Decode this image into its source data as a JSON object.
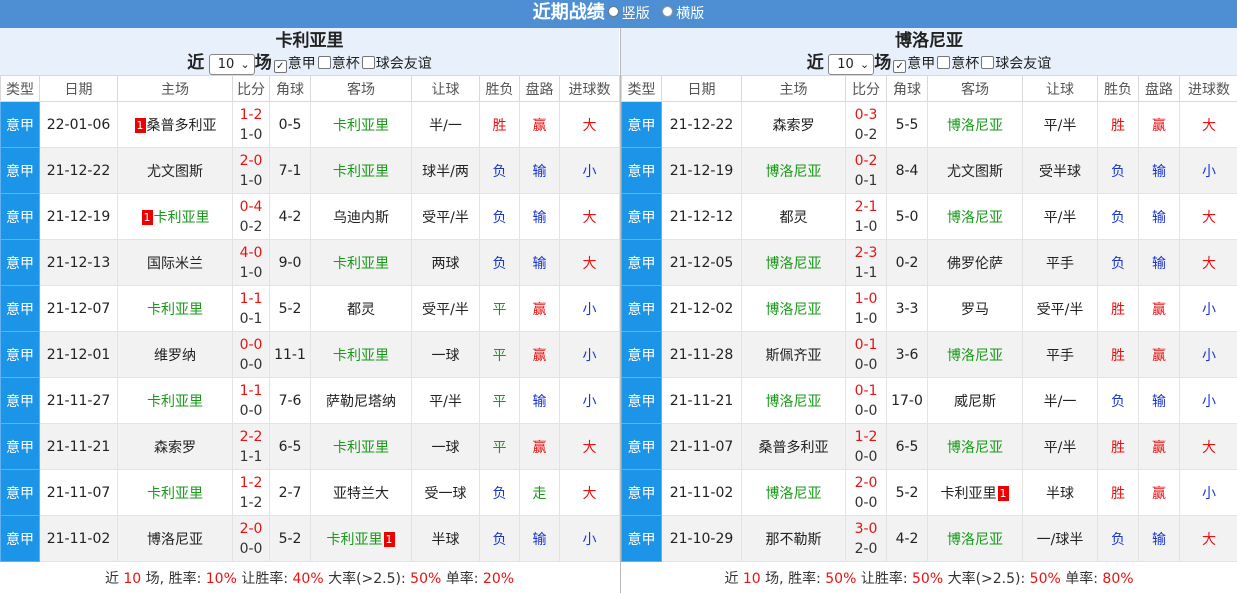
{
  "header": {
    "title": "近期战绩",
    "option_vertical": "竖版",
    "option_horizontal": "横版"
  },
  "colors": {
    "title_bar": "#4d8fd2",
    "type_cell": "#1c95e8",
    "win": "#e81212",
    "lose": "#1a35d6",
    "draw": "#189a18"
  },
  "columns": [
    "类型",
    "日期",
    "主场",
    "比分",
    "角球",
    "客场",
    "让球",
    "胜负",
    "盘路",
    "进球数"
  ],
  "left": {
    "team": "卡利亚里",
    "filter_near": "近",
    "filter_count": "10",
    "filter_unit": "场",
    "cb_serie_a": "意甲",
    "cb_cup": "意杯",
    "cb_friendly": "球会友谊",
    "rows": [
      {
        "type": "意甲",
        "date": "22-01-06",
        "home": "桑普多利亚",
        "home_card": "1",
        "score": "1-2",
        "half": "1-0",
        "corner": "0-5",
        "away": "卡利亚里",
        "away_card": "",
        "hcap": "半/一",
        "result": "胜",
        "pan": "赢",
        "goals": "大"
      },
      {
        "type": "意甲",
        "date": "21-12-22",
        "home": "尤文图斯",
        "home_card": "",
        "score": "2-0",
        "half": "1-0",
        "corner": "7-1",
        "away": "卡利亚里",
        "away_card": "",
        "hcap": "球半/两",
        "result": "负",
        "pan": "输",
        "goals": "小"
      },
      {
        "type": "意甲",
        "date": "21-12-19",
        "home": "卡利亚里",
        "home_card": "1",
        "score": "0-4",
        "half": "0-2",
        "corner": "4-2",
        "away": "乌迪内斯",
        "away_card": "",
        "hcap": "受平/半",
        "result": "负",
        "pan": "输",
        "goals": "大"
      },
      {
        "type": "意甲",
        "date": "21-12-13",
        "home": "国际米兰",
        "home_card": "",
        "score": "4-0",
        "half": "1-0",
        "corner": "9-0",
        "away": "卡利亚里",
        "away_card": "",
        "hcap": "两球",
        "result": "负",
        "pan": "输",
        "goals": "大"
      },
      {
        "type": "意甲",
        "date": "21-12-07",
        "home": "卡利亚里",
        "home_card": "",
        "score": "1-1",
        "half": "0-1",
        "corner": "5-2",
        "away": "都灵",
        "away_card": "",
        "hcap": "受平/半",
        "result": "平",
        "pan": "赢",
        "goals": "小"
      },
      {
        "type": "意甲",
        "date": "21-12-01",
        "home": "维罗纳",
        "home_card": "",
        "score": "0-0",
        "half": "0-0",
        "corner": "11-1",
        "away": "卡利亚里",
        "away_card": "",
        "hcap": "一球",
        "result": "平",
        "pan": "赢",
        "goals": "小"
      },
      {
        "type": "意甲",
        "date": "21-11-27",
        "home": "卡利亚里",
        "home_card": "",
        "score": "1-1",
        "half": "0-0",
        "corner": "7-6",
        "away": "萨勒尼塔纳",
        "away_card": "",
        "hcap": "平/半",
        "result": "平",
        "pan": "输",
        "goals": "小"
      },
      {
        "type": "意甲",
        "date": "21-11-21",
        "home": "森索罗",
        "home_card": "",
        "score": "2-2",
        "half": "1-1",
        "corner": "6-5",
        "away": "卡利亚里",
        "away_card": "",
        "hcap": "一球",
        "result": "平",
        "pan": "赢",
        "goals": "大"
      },
      {
        "type": "意甲",
        "date": "21-11-07",
        "home": "卡利亚里",
        "home_card": "",
        "score": "1-2",
        "half": "1-2",
        "corner": "2-7",
        "away": "亚特兰大",
        "away_card": "",
        "hcap": "受一球",
        "result": "负",
        "pan": "走",
        "goals": "大"
      },
      {
        "type": "意甲",
        "date": "21-11-02",
        "home": "博洛尼亚",
        "home_card": "",
        "score": "2-0",
        "half": "0-0",
        "corner": "5-2",
        "away": "卡利亚里",
        "away_card": "1",
        "hcap": "半球",
        "result": "负",
        "pan": "输",
        "goals": "小"
      }
    ],
    "summary": {
      "p1": "近 ",
      "n": "10",
      "p2": " 场, 胜率: ",
      "win": "10%",
      "p3": " 让胜率: ",
      "hwin": "40%",
      "p4": " 大率(>2.5): ",
      "big": "50%",
      "p5": " 单率: ",
      "odd": "20%"
    }
  },
  "right": {
    "team": "博洛尼亚",
    "filter_near": "近",
    "filter_count": "10",
    "filter_unit": "场",
    "cb_serie_a": "意甲",
    "cb_cup": "意杯",
    "cb_friendly": "球会友谊",
    "rows": [
      {
        "type": "意甲",
        "date": "21-12-22",
        "home": "森索罗",
        "home_card": "",
        "score": "0-3",
        "half": "0-2",
        "corner": "5-5",
        "away": "博洛尼亚",
        "away_card": "",
        "hcap": "平/半",
        "result": "胜",
        "pan": "赢",
        "goals": "大"
      },
      {
        "type": "意甲",
        "date": "21-12-19",
        "home": "博洛尼亚",
        "home_card": "",
        "score": "0-2",
        "half": "0-1",
        "corner": "8-4",
        "away": "尤文图斯",
        "away_card": "",
        "hcap": "受半球",
        "result": "负",
        "pan": "输",
        "goals": "小"
      },
      {
        "type": "意甲",
        "date": "21-12-12",
        "home": "都灵",
        "home_card": "",
        "score": "2-1",
        "half": "1-0",
        "corner": "5-0",
        "away": "博洛尼亚",
        "away_card": "",
        "hcap": "平/半",
        "result": "负",
        "pan": "输",
        "goals": "大"
      },
      {
        "type": "意甲",
        "date": "21-12-05",
        "home": "博洛尼亚",
        "home_card": "",
        "score": "2-3",
        "half": "1-1",
        "corner": "0-2",
        "away": "佛罗伦萨",
        "away_card": "",
        "hcap": "平手",
        "result": "负",
        "pan": "输",
        "goals": "大"
      },
      {
        "type": "意甲",
        "date": "21-12-02",
        "home": "博洛尼亚",
        "home_card": "",
        "score": "1-0",
        "half": "1-0",
        "corner": "3-3",
        "away": "罗马",
        "away_card": "",
        "hcap": "受平/半",
        "result": "胜",
        "pan": "赢",
        "goals": "小"
      },
      {
        "type": "意甲",
        "date": "21-11-28",
        "home": "斯佩齐亚",
        "home_card": "",
        "score": "0-1",
        "half": "0-0",
        "corner": "3-6",
        "away": "博洛尼亚",
        "away_card": "",
        "hcap": "平手",
        "result": "胜",
        "pan": "赢",
        "goals": "小"
      },
      {
        "type": "意甲",
        "date": "21-11-21",
        "home": "博洛尼亚",
        "home_card": "",
        "score": "0-1",
        "half": "0-0",
        "corner": "17-0",
        "away": "威尼斯",
        "away_card": "",
        "hcap": "半/一",
        "result": "负",
        "pan": "输",
        "goals": "小"
      },
      {
        "type": "意甲",
        "date": "21-11-07",
        "home": "桑普多利亚",
        "home_card": "",
        "score": "1-2",
        "half": "0-0",
        "corner": "6-5",
        "away": "博洛尼亚",
        "away_card": "",
        "hcap": "平/半",
        "result": "胜",
        "pan": "赢",
        "goals": "大"
      },
      {
        "type": "意甲",
        "date": "21-11-02",
        "home": "博洛尼亚",
        "home_card": "",
        "score": "2-0",
        "half": "0-0",
        "corner": "5-2",
        "away": "卡利亚里",
        "away_card": "1",
        "hcap": "半球",
        "result": "胜",
        "pan": "赢",
        "goals": "小"
      },
      {
        "type": "意甲",
        "date": "21-10-29",
        "home": "那不勒斯",
        "home_card": "",
        "score": "3-0",
        "half": "2-0",
        "corner": "4-2",
        "away": "博洛尼亚",
        "away_card": "",
        "hcap": "一/球半",
        "result": "负",
        "pan": "输",
        "goals": "大"
      }
    ],
    "summary": {
      "p1": "近 ",
      "n": "10",
      "p2": " 场, 胜率: ",
      "win": "50%",
      "p3": " 让胜率: ",
      "hwin": "50%",
      "p4": " 大率(>2.5): ",
      "big": "50%",
      "p5": " 单率: ",
      "odd": "80%"
    }
  }
}
